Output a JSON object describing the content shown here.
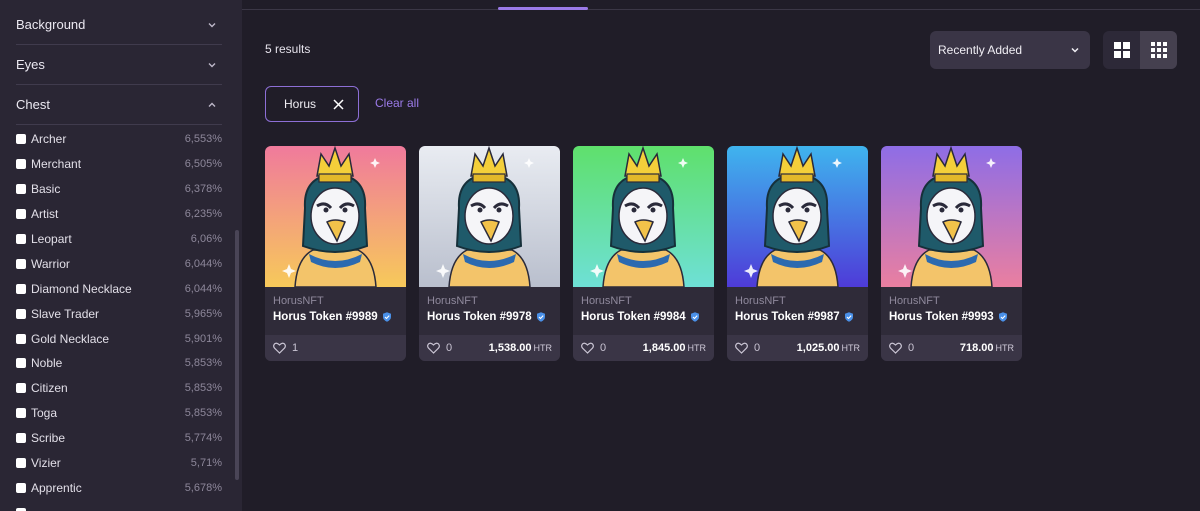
{
  "sidebar": {
    "groups": [
      {
        "label": "Background"
      },
      {
        "label": "Eyes"
      },
      {
        "label": "Chest"
      }
    ],
    "traits": [
      {
        "name": "Archer",
        "pct": "6,553%"
      },
      {
        "name": "Merchant",
        "pct": "6,505%"
      },
      {
        "name": "Basic",
        "pct": "6,378%"
      },
      {
        "name": "Artist",
        "pct": "6,235%"
      },
      {
        "name": "Leopart",
        "pct": "6,06%"
      },
      {
        "name": "Warrior",
        "pct": "6,044%"
      },
      {
        "name": "Diamond Necklace",
        "pct": "6,044%"
      },
      {
        "name": "Slave Trader",
        "pct": "5,965%"
      },
      {
        "name": "Gold Necklace",
        "pct": "5,901%"
      },
      {
        "name": "Noble",
        "pct": "5,853%"
      },
      {
        "name": "Citizen",
        "pct": "5,853%"
      },
      {
        "name": "Toga",
        "pct": "5,853%"
      },
      {
        "name": "Scribe",
        "pct": "5,774%"
      },
      {
        "name": "Vizier",
        "pct": "5,71%"
      },
      {
        "name": "Apprentic",
        "pct": "5,678%"
      }
    ]
  },
  "main": {
    "results": "5 results",
    "sort": {
      "selected": "Recently Added"
    },
    "filter_chip": {
      "label": "Horus"
    },
    "clear_all": "Clear all",
    "cards": [
      {
        "collection": "HorusNFT",
        "name": "Horus Token #9989",
        "likes": "1",
        "price": "",
        "currency": "",
        "bg_top": "#f07a9c",
        "bg_bottom": "#f7c95a"
      },
      {
        "collection": "HorusNFT",
        "name": "Horus Token #9978",
        "likes": "0",
        "price": "1,538.00",
        "currency": "HTR",
        "bg_top": "#e9ecf2",
        "bg_bottom": "#b9bfcd"
      },
      {
        "collection": "HorusNFT",
        "name": "Horus Token #9984",
        "likes": "0",
        "price": "1,845.00",
        "currency": "HTR",
        "bg_top": "#5fe06c",
        "bg_bottom": "#6ee0d6"
      },
      {
        "collection": "HorusNFT",
        "name": "Horus Token #9987",
        "likes": "0",
        "price": "1,025.00",
        "currency": "HTR",
        "bg_top": "#3fb4ee",
        "bg_bottom": "#4e3bd8"
      },
      {
        "collection": "HorusNFT",
        "name": "Horus Token #9993",
        "likes": "0",
        "price": "718.00",
        "currency": "HTR",
        "bg_top": "#8e6de6",
        "bg_bottom": "#ea7fa0"
      }
    ]
  },
  "colors": {
    "accent": "#9b7ae8",
    "verified": "#4a90e8"
  }
}
